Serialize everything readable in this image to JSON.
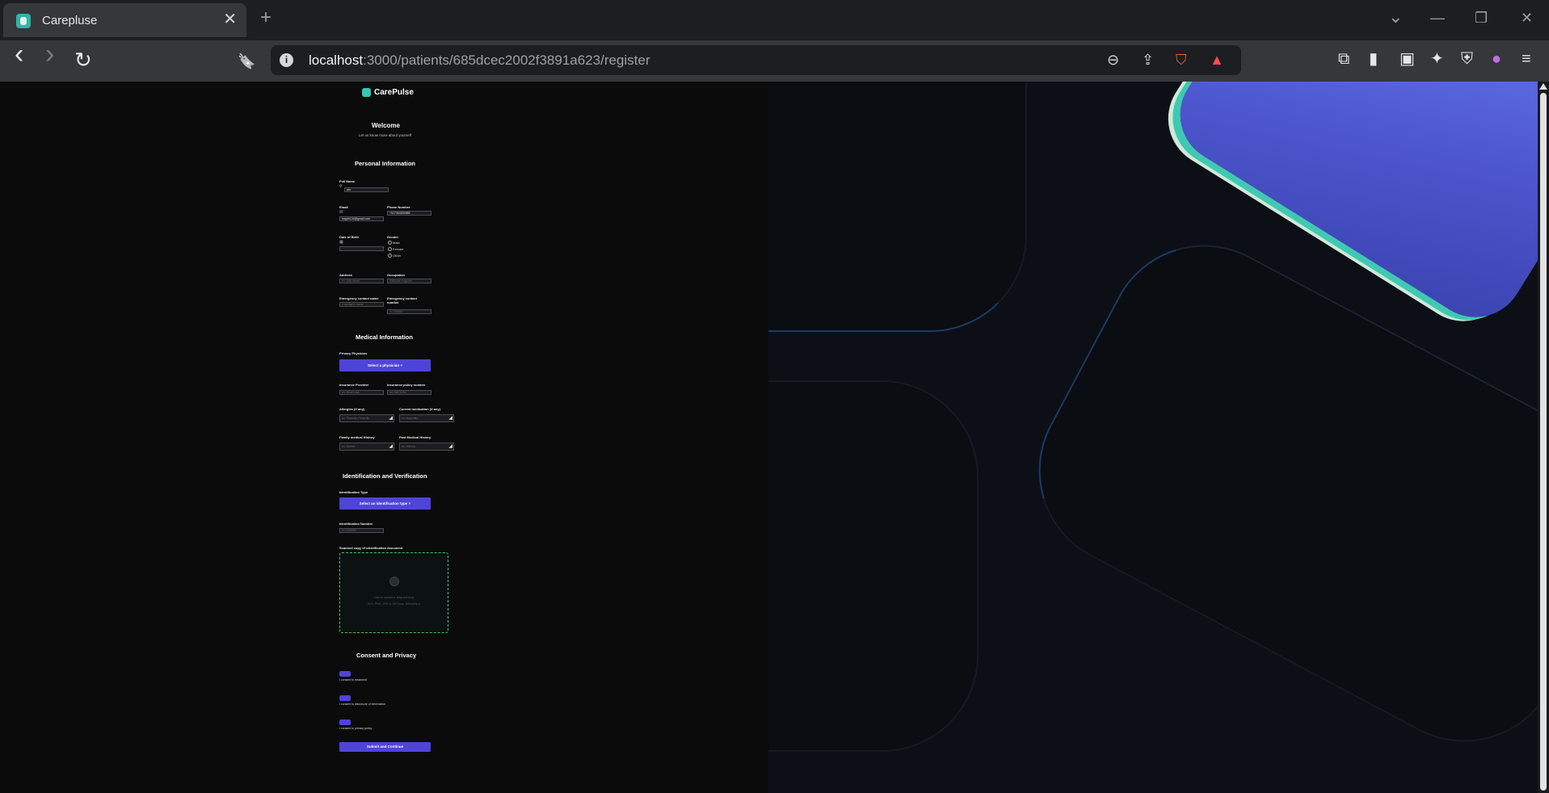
{
  "browser": {
    "tab_title": "Carepluse",
    "tab_close": "✕",
    "new_tab": "+",
    "window_controls": {
      "dropdown": "⌄",
      "minimize": "—",
      "restore": "❐",
      "close": "✕"
    },
    "nav": {
      "back": "‹",
      "forward": "›",
      "reload": "↻",
      "bookmark": "🔖"
    },
    "url_host": "localhost",
    "url_rest": ":3000/patients/685dcec2002f3891a623/register",
    "url_info": "i"
  },
  "page": {
    "brand": "CarePulse",
    "welcome": "Welcome",
    "welcome_sub": "Let us know more about yourself",
    "sections": {
      "personal": "Personal Information",
      "medical": "Medical Information",
      "identification": "Identification and Verification",
      "consent": "Consent and Privacy"
    },
    "personal": {
      "full_name_label": "Full Name",
      "full_name_value": "pta",
      "email_label": "Email",
      "email_value": "hagdn134@gmail.com",
      "phone_label": "Phone Number",
      "phone_value": "+917364639988",
      "dob_label": "Date of Birth",
      "gender_label": "Gender",
      "gender_options": [
        "Male",
        "Female",
        "Other"
      ],
      "address_label": "Address",
      "address_placeholder": "ex: 14th street",
      "occupation_label": "Occupation",
      "occupation_placeholder": "Software engineer",
      "emergency_name_label": "Emergency contact name",
      "emergency_name_placeholder": "Guardian's name",
      "emergency_number_label": "Emergency contact number",
      "emergency_number_placeholder": "+1 234567"
    },
    "medical": {
      "physician_label": "Privacy Physician",
      "physician_button": "Select a physician ˅",
      "insurance_provider_label": "Insurance Provider",
      "insurance_provider_placeholder": "ex: BlueCross",
      "insurance_number_label": "Insurance policy number",
      "insurance_number_placeholder": "ex: ABC1234",
      "allergies_label": "Allergies (if any)",
      "allergies_placeholder": "ex: Peanuts, Penicillin",
      "medication_label": "Current medication (if any)",
      "medication_placeholder": "ex: Ibuprofen",
      "family_history_label": "Family medical History",
      "family_history_placeholder": "ex: Mother",
      "past_history_label": "Past Medical History",
      "past_history_placeholder": "ex: Asthma"
    },
    "identification": {
      "type_label": "Identification Type",
      "type_button": "Select an identification type ˅",
      "number_label": "Identification Number",
      "number_placeholder": "ex 1234567",
      "upload_label": "Scanned copy of identification document",
      "upload_line1": "Click to upload or drag and drop",
      "upload_line2": "SVG, PNG, JPG or GIF (max. 800x400px)"
    },
    "consent": {
      "treatment": "I consent to treatment",
      "disclosure": "I consent to disclosure of information",
      "privacy": "I consent to privacy policy",
      "submit": "Submit and Continue"
    }
  }
}
